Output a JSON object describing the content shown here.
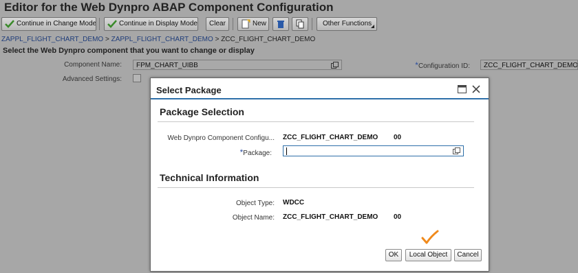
{
  "app": {
    "title": "Editor for the Web Dynpro ABAP Component Configuration"
  },
  "toolbar": {
    "change_mode": "Continue in Change Mode",
    "display_mode": "Continue in Display Mode",
    "clear": "Clear",
    "new": "New",
    "other": "Other Functions"
  },
  "breadcrumb": {
    "items": [
      "ZAPPL_FLIGHT_CHART_DEMO",
      "ZAPPL_FLIGHT_CHART_DEMO",
      "ZCC_FLIGHT_CHART_DEMO"
    ],
    "separator": ">"
  },
  "instruction": "Select the Web Dynpro component that you want to change or display",
  "form": {
    "component_label": "Component Name:",
    "component_value": "FPM_CHART_UIBB",
    "advanced_label": "Advanced Settings:",
    "config_label": "Configuration ID:",
    "config_value": "ZCC_FLIGHT_CHART_DEMO",
    "required_mark": "*"
  },
  "dialog": {
    "title": "Select Package",
    "section1": "Package Selection",
    "wdcc_label": "Web Dynpro Component Configu...",
    "wdcc_value": "ZCC_FLIGHT_CHART_DEMO",
    "wdcc_version": "00",
    "package_label": "Package:",
    "package_value": "",
    "section2": "Technical Information",
    "obj_type_label": "Object Type:",
    "obj_type_value": "WDCC",
    "obj_name_label": "Object Name:",
    "obj_name_value": "ZCC_FLIGHT_CHART_DEMO",
    "obj_name_version": "00",
    "ok": "OK",
    "local_object": "Local Object",
    "cancel": "Cancel"
  },
  "colors": {
    "accent": "#2c6ea8",
    "checkmark_green": "#3a8a2a",
    "annotation_orange": "#f08a1c"
  }
}
